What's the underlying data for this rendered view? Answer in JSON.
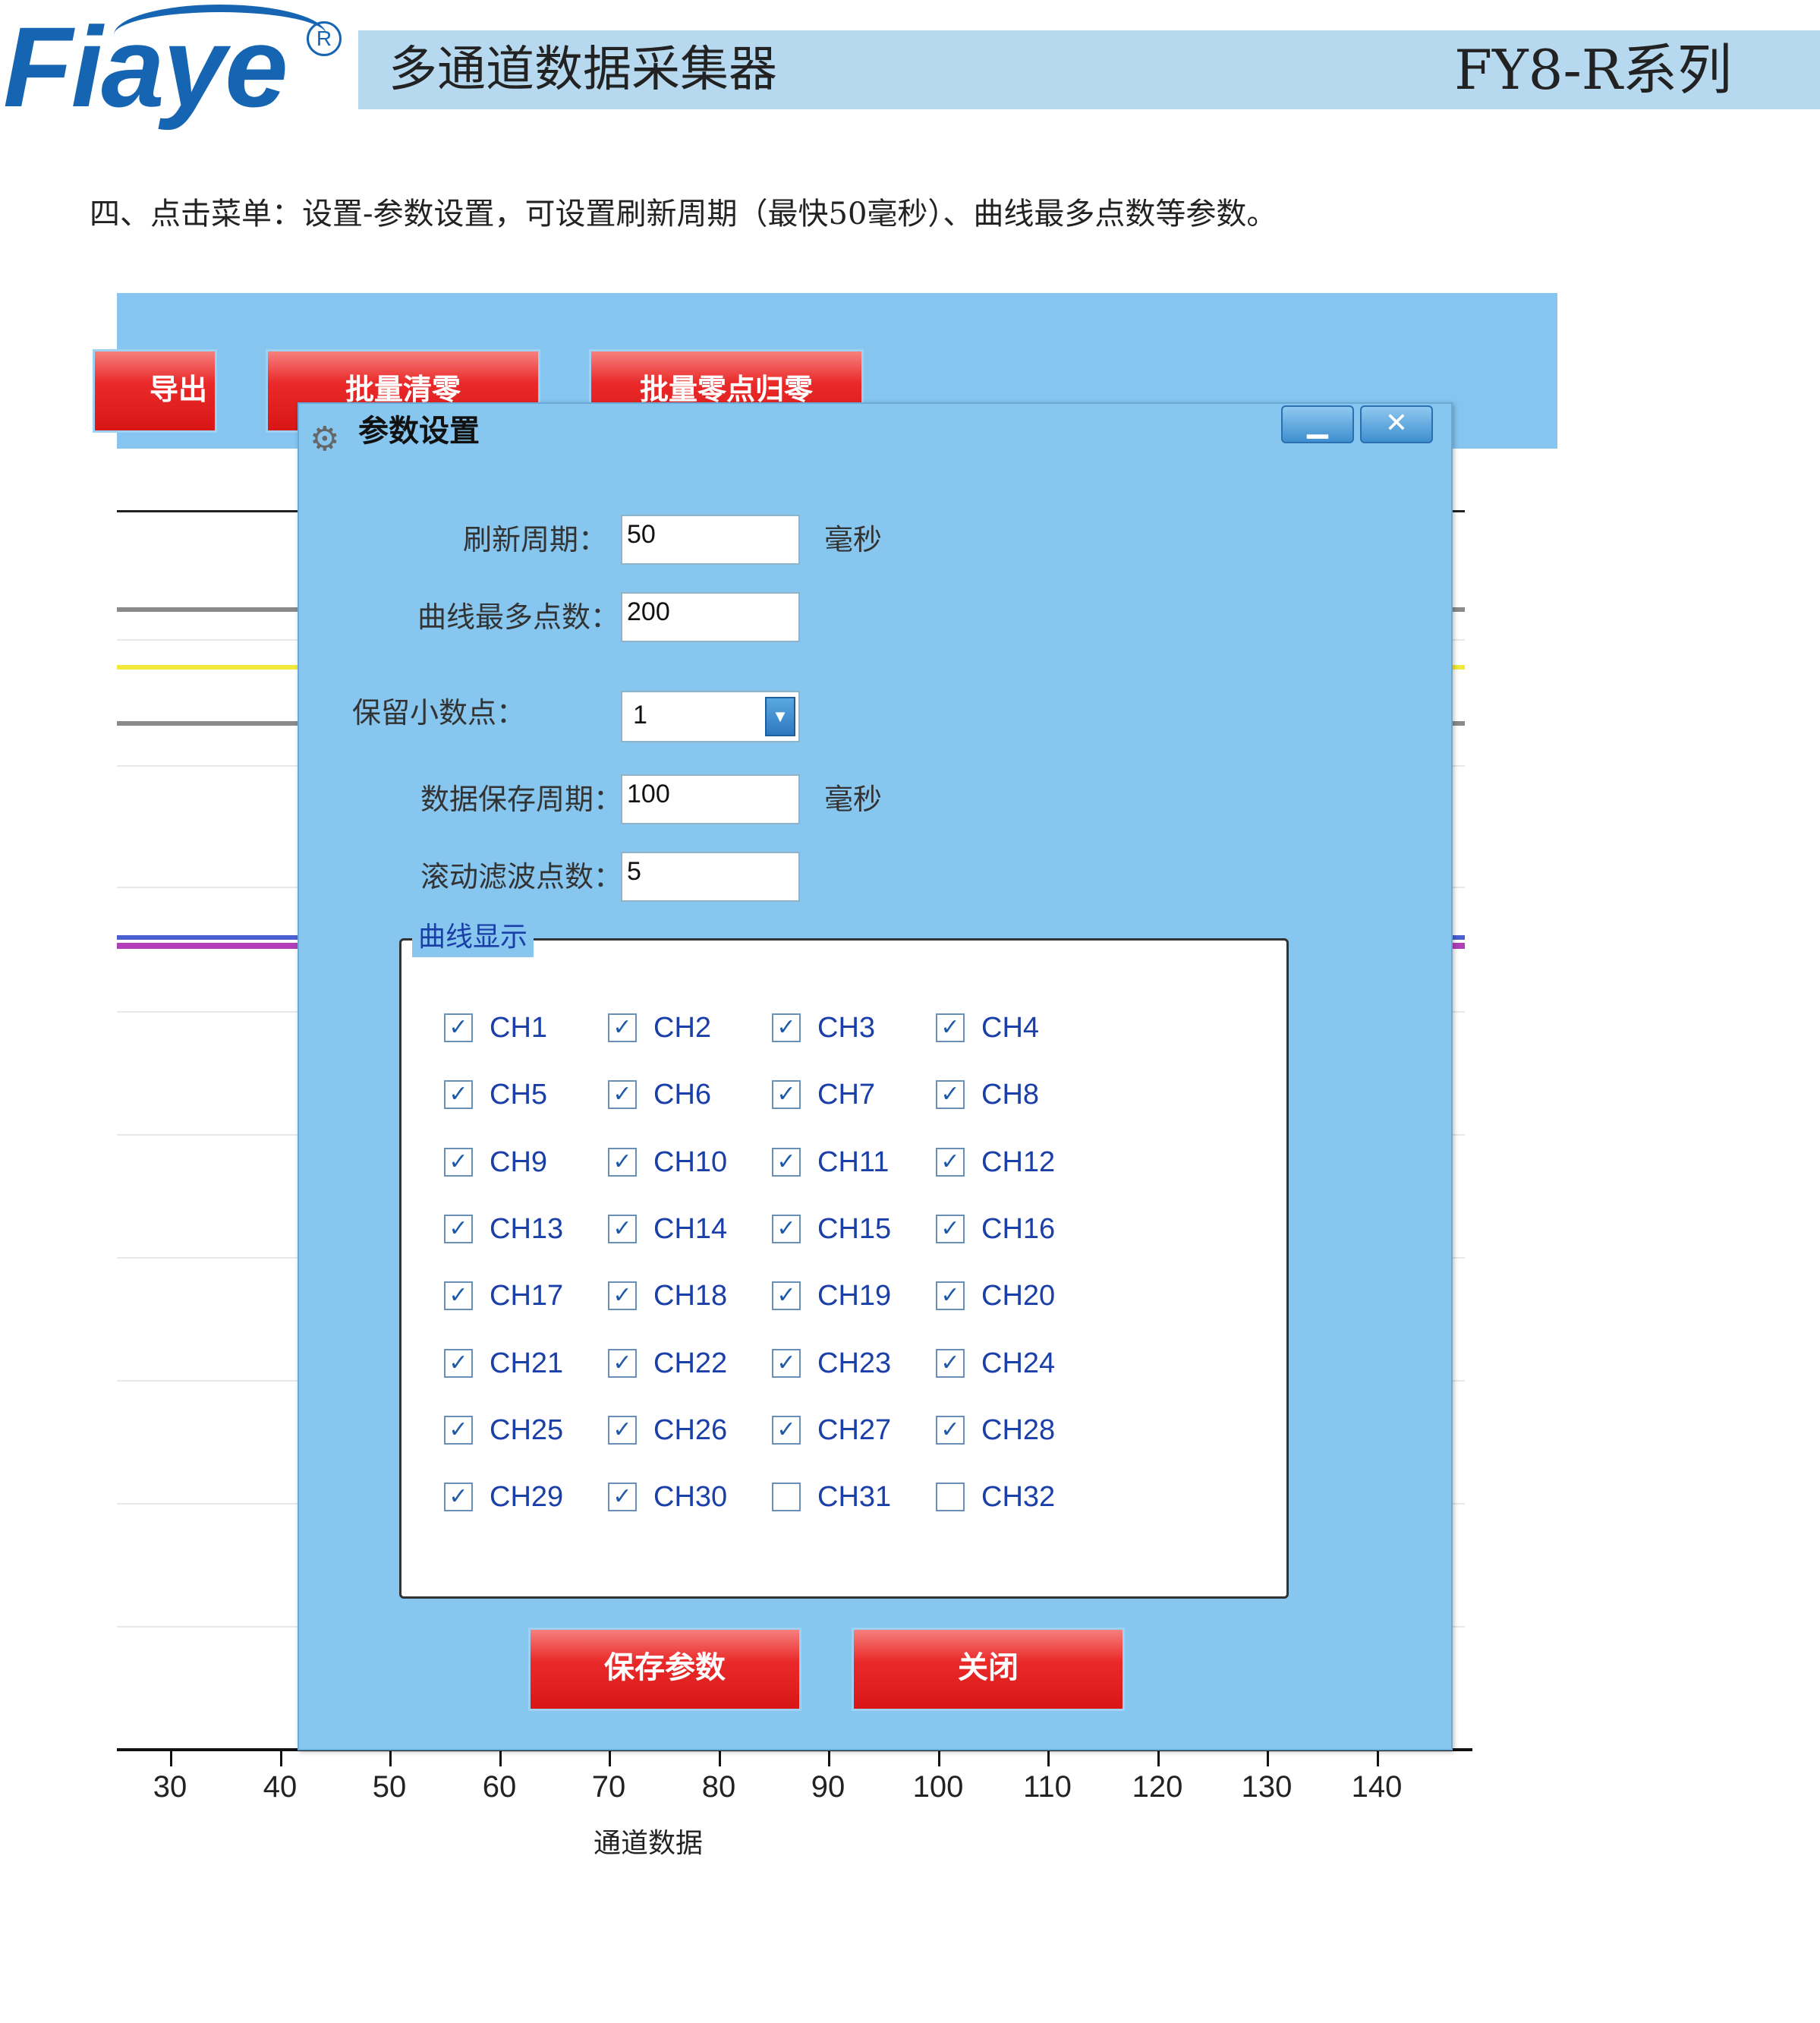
{
  "header": {
    "logo_text": "Fiaye",
    "registered_mark": "R",
    "product_title": "多通道数据采集器",
    "series": "FY8-R系列"
  },
  "instruction": "四、点击菜单：设置-参数设置，可设置刷新周期（最快50毫秒）、曲线最多点数等参数。",
  "toolbar": {
    "buttons": [
      "导出",
      "批量清零",
      "批量零点归零"
    ]
  },
  "colors": {
    "toolbar_bg": "#85c5ef",
    "dialog_bg": "#86c6ef",
    "button_red": "#e21f1f",
    "header_band": "#b6d9ef",
    "logo_blue": "#1665b3",
    "checkbox_text": "#1a3fa8"
  },
  "chart": {
    "x_ticks": [
      "30",
      "40",
      "50",
      "60",
      "70",
      "80",
      "90",
      "100",
      "110",
      "120",
      "130",
      "140"
    ],
    "x_title": "通道数据"
  },
  "dialog": {
    "icon": "gear-icon",
    "title": "参数设置",
    "minimize_glyph": "▁",
    "close_glyph": "✕",
    "refresh_label": "刷新周期：",
    "refresh_value": "50",
    "refresh_unit": "毫秒",
    "max_points_label": "曲线最多点数：",
    "max_points_value": "200",
    "decimals_label": "保留小数点：",
    "decimals_value": "1",
    "save_period_label": "数据保存周期：",
    "save_period_value": "100",
    "save_period_unit": "毫秒",
    "filter_label": "滚动滤波点数：",
    "filter_value": "5",
    "group_title": "曲线显示",
    "channels": [
      {
        "label": "CH1",
        "checked": true
      },
      {
        "label": "CH2",
        "checked": true
      },
      {
        "label": "CH3",
        "checked": true
      },
      {
        "label": "CH4",
        "checked": true
      },
      {
        "label": "CH5",
        "checked": true
      },
      {
        "label": "CH6",
        "checked": true
      },
      {
        "label": "CH7",
        "checked": true
      },
      {
        "label": "CH8",
        "checked": true
      },
      {
        "label": "CH9",
        "checked": true
      },
      {
        "label": "CH10",
        "checked": true
      },
      {
        "label": "CH11",
        "checked": true
      },
      {
        "label": "CH12",
        "checked": true
      },
      {
        "label": "CH13",
        "checked": true
      },
      {
        "label": "CH14",
        "checked": true
      },
      {
        "label": "CH15",
        "checked": true
      },
      {
        "label": "CH16",
        "checked": true
      },
      {
        "label": "CH17",
        "checked": true
      },
      {
        "label": "CH18",
        "checked": true
      },
      {
        "label": "CH19",
        "checked": true
      },
      {
        "label": "CH20",
        "checked": true
      },
      {
        "label": "CH21",
        "checked": true
      },
      {
        "label": "CH22",
        "checked": true
      },
      {
        "label": "CH23",
        "checked": true
      },
      {
        "label": "CH24",
        "checked": true
      },
      {
        "label": "CH25",
        "checked": true
      },
      {
        "label": "CH26",
        "checked": true
      },
      {
        "label": "CH27",
        "checked": true
      },
      {
        "label": "CH28",
        "checked": true
      },
      {
        "label": "CH29",
        "checked": true
      },
      {
        "label": "CH30",
        "checked": true
      },
      {
        "label": "CH31",
        "checked": false
      },
      {
        "label": "CH32",
        "checked": false
      }
    ],
    "save_button": "保存参数",
    "close_button": "关闭"
  }
}
